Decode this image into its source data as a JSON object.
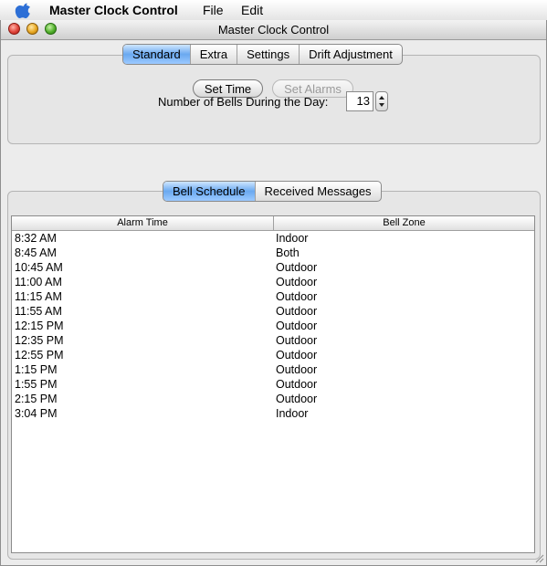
{
  "menubar": {
    "app_name": "Master Clock Control",
    "items": [
      "File",
      "Edit"
    ]
  },
  "window": {
    "title": "Master Clock Control"
  },
  "top_tabs": [
    "Standard",
    "Extra",
    "Settings",
    "Drift Adjustment"
  ],
  "actions": {
    "set_time": "Set Time",
    "set_alarms": "Set Alarms"
  },
  "bells": {
    "label": "Number of Bells During the Day:",
    "value": "13"
  },
  "bottom_tabs": [
    "Bell Schedule",
    "Received Messages"
  ],
  "table": {
    "headers": [
      "Alarm Time",
      "Bell Zone"
    ],
    "rows": [
      [
        "8:32 AM",
        "Indoor"
      ],
      [
        "8:45 AM",
        "Both"
      ],
      [
        "10:45 AM",
        "Outdoor"
      ],
      [
        "11:00 AM",
        "Outdoor"
      ],
      [
        "11:15 AM",
        "Outdoor"
      ],
      [
        "11:55 AM",
        "Outdoor"
      ],
      [
        "12:15 PM",
        "Outdoor"
      ],
      [
        "12:35 PM",
        "Outdoor"
      ],
      [
        "12:55 PM",
        "Outdoor"
      ],
      [
        "1:15 PM",
        "Outdoor"
      ],
      [
        "1:55 PM",
        "Outdoor"
      ],
      [
        "2:15 PM",
        "Outdoor"
      ],
      [
        "3:04 PM",
        "Indoor"
      ]
    ]
  }
}
